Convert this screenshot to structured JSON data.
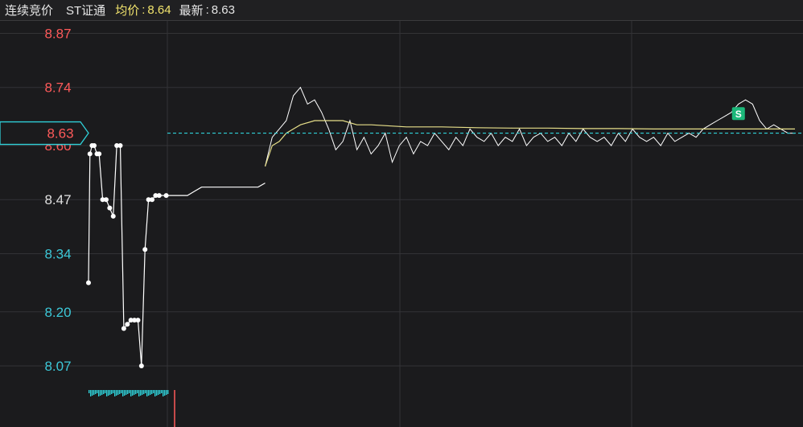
{
  "header": {
    "mode": "连续竞价",
    "stock_name": "ST证通",
    "avg_label": "均价",
    "avg_value": "8.64",
    "last_label": "最新",
    "last_value": "8.63",
    "separator": ":"
  },
  "colors": {
    "background": "#1b1b1d",
    "grid": "#333336",
    "up": "#ff5a5a",
    "down": "#3cc8d8",
    "neutral": "#e0e0e0",
    "price_line": "#ffffff",
    "avg_line": "#e8e08a",
    "current_price": "#2fd0d8",
    "signal": "#1cb87a"
  },
  "chart_data": {
    "type": "line",
    "title": "",
    "y_ticks": [
      "8.87",
      "8.74",
      "8.60",
      "8.47",
      "8.34",
      "8.20",
      "8.07"
    ],
    "y_tick_colors": [
      "up",
      "up",
      "up",
      "neutral",
      "down",
      "down",
      "down"
    ],
    "ylim": [
      8.01,
      8.9
    ],
    "xlim": [
      0,
      100
    ],
    "grid": true,
    "current_price_label": "8.63",
    "current_price": 8.63,
    "signal_marker": {
      "label": "S",
      "x": 92,
      "y": 8.65
    },
    "auction": {
      "x": [
        0,
        0.2,
        0.5,
        0.8,
        1.2,
        1.5,
        2,
        2.5,
        3,
        3.5,
        4,
        4.5,
        5,
        5.5,
        6,
        6.5,
        7,
        7.5,
        8,
        8.5,
        9,
        9.5,
        10,
        11,
        12,
        13,
        14,
        15,
        16,
        17,
        18,
        19,
        20,
        21,
        22,
        23,
        24,
        25
      ],
      "y": [
        8.27,
        8.58,
        8.6,
        8.6,
        8.58,
        8.58,
        8.47,
        8.47,
        8.45,
        8.43,
        8.6,
        8.6,
        8.16,
        8.17,
        8.18,
        8.18,
        8.18,
        8.07,
        8.35,
        8.47,
        8.47,
        8.48,
        8.48,
        8.48,
        8.48,
        8.48,
        8.48,
        8.49,
        8.5,
        8.5,
        8.5,
        8.5,
        8.5,
        8.5,
        8.5,
        8.5,
        8.5,
        8.51
      ]
    },
    "series": [
      {
        "name": "",
        "role": "price",
        "x": [
          25,
          26,
          27,
          28,
          29,
          30,
          31,
          32,
          33,
          34,
          35,
          36,
          37,
          38,
          39,
          40,
          41,
          42,
          43,
          44,
          45,
          46,
          47,
          48,
          49,
          50,
          51,
          52,
          53,
          54,
          55,
          56,
          57,
          58,
          59,
          60,
          61,
          62,
          63,
          64,
          65,
          66,
          67,
          68,
          69,
          70,
          71,
          72,
          73,
          74,
          75,
          76,
          77,
          78,
          79,
          80,
          81,
          82,
          83,
          84,
          85,
          86,
          87,
          88,
          89,
          90,
          91,
          92,
          93,
          94,
          95,
          96,
          97,
          98,
          99,
          100
        ],
        "y": [
          8.55,
          8.62,
          8.64,
          8.66,
          8.72,
          8.74,
          8.7,
          8.71,
          8.68,
          8.64,
          8.59,
          8.61,
          8.66,
          8.59,
          8.62,
          8.58,
          8.6,
          8.63,
          8.56,
          8.6,
          8.62,
          8.58,
          8.61,
          8.6,
          8.63,
          8.61,
          8.59,
          8.62,
          8.6,
          8.64,
          8.62,
          8.61,
          8.63,
          8.6,
          8.62,
          8.61,
          8.64,
          8.6,
          8.62,
          8.63,
          8.61,
          8.62,
          8.6,
          8.63,
          8.61,
          8.64,
          8.62,
          8.61,
          8.62,
          8.6,
          8.63,
          8.61,
          8.64,
          8.62,
          8.61,
          8.62,
          8.6,
          8.63,
          8.61,
          8.62,
          8.63,
          8.62,
          8.64,
          8.65,
          8.66,
          8.67,
          8.68,
          8.7,
          8.71,
          8.7,
          8.66,
          8.64,
          8.65,
          8.64,
          8.63,
          8.63
        ]
      },
      {
        "name": "",
        "role": "average",
        "x": [
          25,
          26,
          27,
          28,
          29,
          30,
          32,
          34,
          36,
          38,
          40,
          45,
          50,
          55,
          60,
          65,
          70,
          75,
          80,
          85,
          90,
          95,
          100
        ],
        "y": [
          8.55,
          8.6,
          8.61,
          8.63,
          8.64,
          8.65,
          8.66,
          8.66,
          8.66,
          8.65,
          8.65,
          8.645,
          8.645,
          8.643,
          8.642,
          8.642,
          8.641,
          8.641,
          8.64,
          8.64,
          8.64,
          8.64,
          8.64
        ]
      }
    ]
  }
}
